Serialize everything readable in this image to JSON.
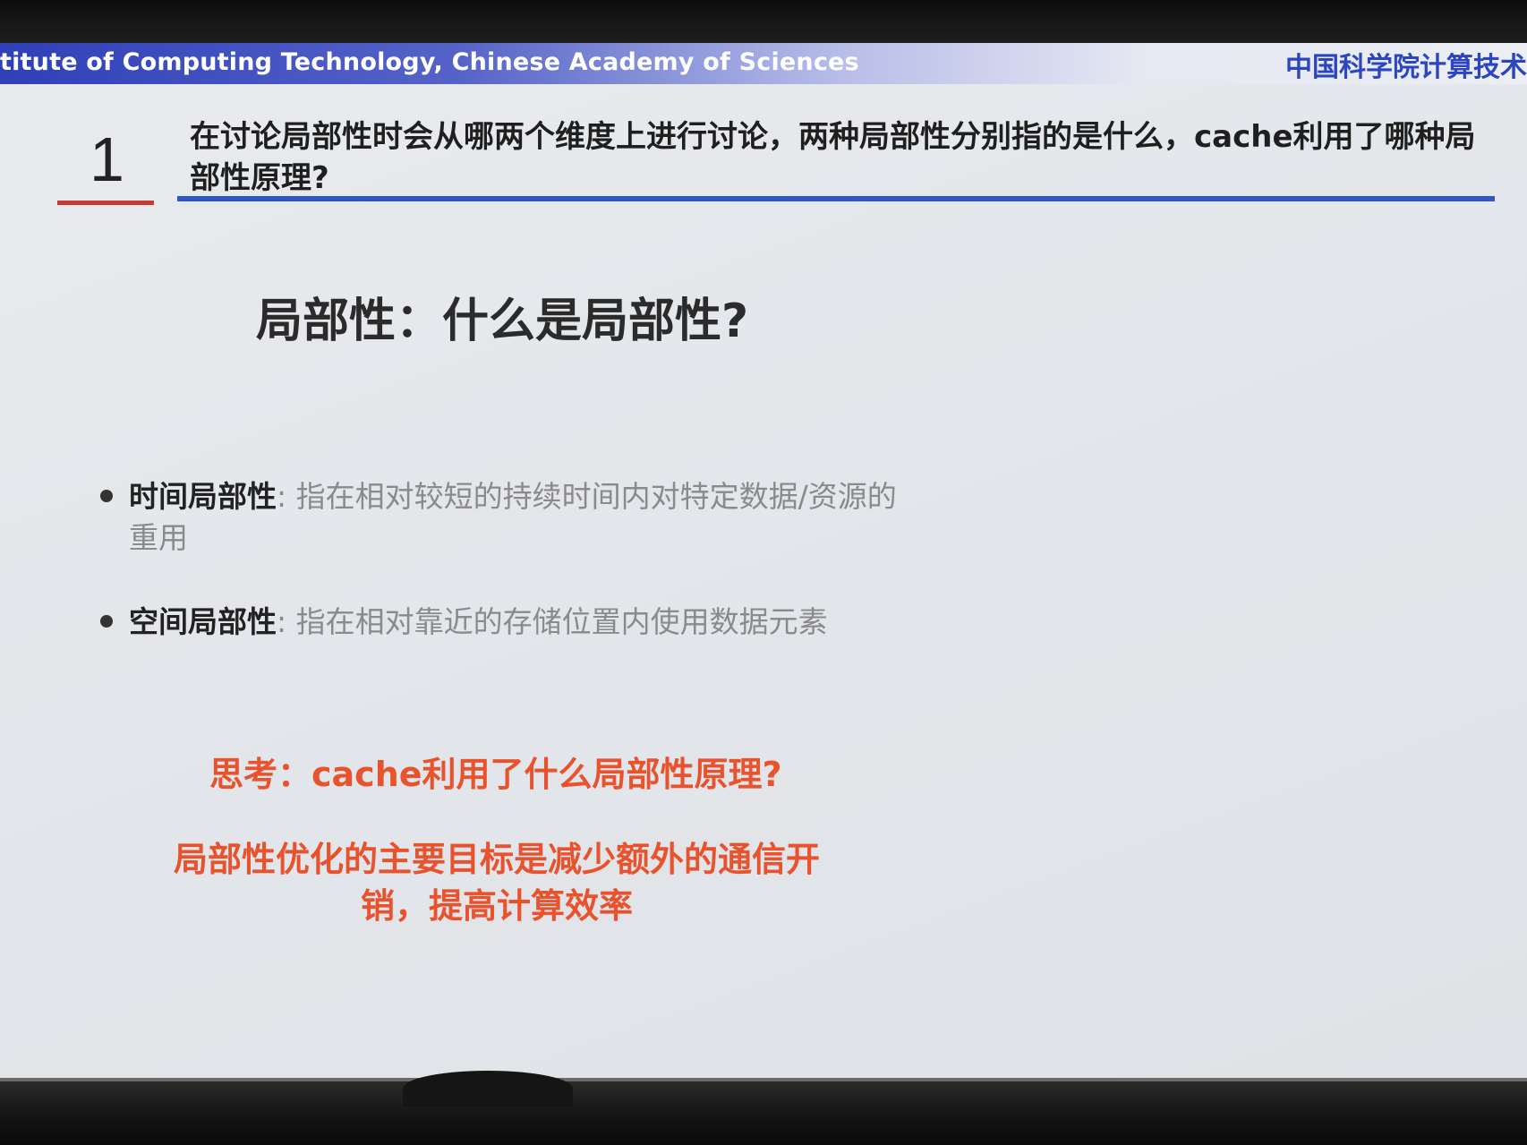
{
  "header": {
    "english": "titute of Computing Technology, Chinese Academy of Sciences",
    "chinese": "中国科学院计算技术"
  },
  "question": {
    "number": "1",
    "text": "在讨论局部性时会从哪两个维度上进行讨论，两种局部性分别指的是什么，cache利用了哪种局部性原理?"
  },
  "slide": {
    "title": "局部性：什么是局部性?",
    "bullets": [
      {
        "term": "时间局部性",
        "separator": ":",
        "desc": "指在相对较短的持续时间内对特定数据/资源的重用"
      },
      {
        "term": "空间局部性",
        "separator": ":",
        "desc": "指在相对靠近的存储位置内使用数据元素"
      }
    ],
    "think": "思考：cache利用了什么局部性原理?",
    "goal": "局部性优化的主要目标是减少额外的通信开销，提高计算效率"
  },
  "colors": {
    "accent_red": "#e8532e",
    "underline_blue": "#2e56c8",
    "number_underline": "#c63a35",
    "header_blue": "#2f40b8"
  }
}
